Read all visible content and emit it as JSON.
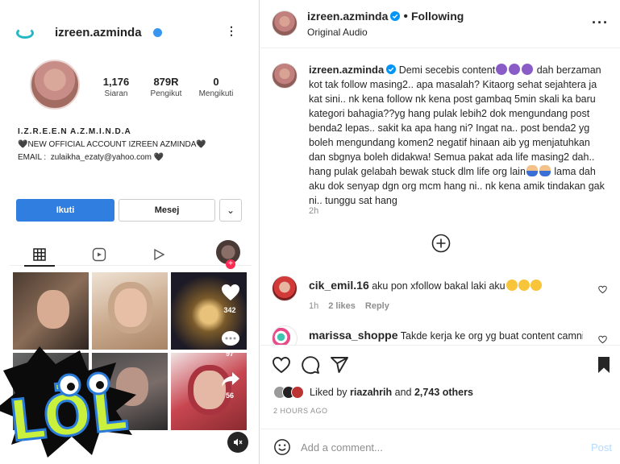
{
  "media": {
    "screenshot": {
      "username": "izreen.azminda",
      "stats": [
        {
          "num": "1,176",
          "label": "Siaran"
        },
        {
          "num": "879R",
          "label": "Pengikut"
        },
        {
          "num": "0",
          "label": "Mengikuti"
        }
      ],
      "bio_name": "I.Z.R.E.E.N A.Z.M.I.N.D.A",
      "bio_line2": "🖤NEW OFFICIAL ACCOUNT IZREEN AZMINDA🖤",
      "bio_line3": "EMAIL :  zulaikha_ezaty@yahoo.com 🖤",
      "follow_label": "Ikuti",
      "message_label": "Mesej",
      "side_counts": [
        "342",
        "97",
        "56"
      ]
    },
    "sticker_text": "LÖL"
  },
  "header": {
    "username": "izreen.azminda",
    "following_label": "Following",
    "audio_label": "Original Audio"
  },
  "caption": {
    "username": "izreen.azminda",
    "text_part1": "Demi secebis content",
    "text_part2": "dah berzaman kot tak follow masing2.. apa masalah? Kitaorg sehat sejahtera ja kat sini.. nk kena follow nk kena post gambaq 5min skali ka baru kategori bahagia??yg hang pulak lebih2 dok mengundang post benda2 lepas.. sakit ka apa hang ni? Ingat na.. post benda2 yg boleh mengundang komen2 negatif hinaan aib yg menjatuhkan dan sbgnya boleh didakwa! Semua pakat ada life masing2 dah.. hang pulak gelabah bewak stuck dlm life org lain",
    "text_part3": "lama dah aku dok senyap dgn org mcm hang ni.. nk kena amik tindakan gak ni.. tunggu sat hang",
    "time": "2h"
  },
  "comments": [
    {
      "username": "cik_emil.16",
      "text": "aku pon xfollow bakal laki aku",
      "time": "1h",
      "likes": "2 likes",
      "reply": "Reply"
    },
    {
      "username": "marissa_shoppe",
      "text": "Takde kerja ke org yg buat content camni..",
      "time": "",
      "likes": "",
      "reply": ""
    }
  ],
  "likes": {
    "prefix": "Liked by",
    "user": "riazahrih",
    "middle": "and",
    "count": "2,743 others"
  },
  "post_time": "2 HOURS AGO",
  "comment_box": {
    "placeholder": "Add a comment...",
    "post_label": "Post"
  },
  "colors": {
    "accent": "#0095f6",
    "verified": "#0095f6",
    "follow_button": "#2f7ee0"
  }
}
